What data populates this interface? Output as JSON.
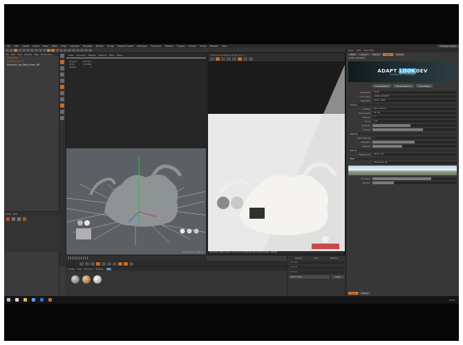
{
  "app": {
    "menu": [
      "File",
      "Edit",
      "Create",
      "Select",
      "Tools",
      "Mesh",
      "Snap",
      "Animate",
      "Simulate",
      "Render",
      "Sculpt",
      "Motion Tracker",
      "MoGraph",
      "Character",
      "Pipeline",
      "Plugins",
      "Octane",
      "Script",
      "Window",
      "Help"
    ],
    "layout_label": "Startup (User)"
  },
  "objects": {
    "header": [
      "File",
      "Edit",
      "View",
      "Objects",
      "Tags",
      "Bookmarks"
    ],
    "rows": [
      "OctaneSky",
      "LightRig_FG_01",
      "Dinosaur_Grp_Fight_Scene_HR"
    ]
  },
  "viewport": {
    "menu": [
      "View",
      "Cameras",
      "Display",
      "Options",
      "Filter",
      "Panel"
    ],
    "label": "Perspective",
    "stats_labels": [
      "Polygons",
      "Points",
      "Objects"
    ],
    "stats_values": [
      "2672914",
      "1341892",
      "4"
    ],
    "grid_label": "Grid Spacing : 1000 cm"
  },
  "liveviewer": {
    "title": "Octane Live Viewer Studio V3 [+]",
    "status": "Rendering: 100%  Ms/sec: 14.9  Time: 00:00:01/00:00:01  Spp/maxspp: 296/296"
  },
  "material": {
    "menu": [
      "Create",
      "Edit",
      "Function",
      "Texture"
    ],
    "filter": "All"
  },
  "coords": {
    "labels": [
      "Position",
      "Size",
      "Rotation"
    ],
    "rows": [
      "X 0 cm",
      "Y 0 cm",
      "Z 0 cm"
    ],
    "apply": "Apply",
    "mode": "Object (Rel)"
  },
  "attributes": {
    "header": [
      "Mode",
      "Edit",
      "User Data"
    ],
    "tabs": [
      "Basic",
      "Coord.",
      "Object",
      "ADAPT",
      "Phong"
    ],
    "object_name": "ADAPT_LOOKDEV",
    "banner_title_a": "ADAPT",
    "banner_title_b": "LOOK",
    "banner_title_c": "DEV",
    "banner_subtitle": "CINEMA 4D | OCTANE",
    "buttons": [
      "Load Material",
      "Reload Material",
      "Save Preset"
    ],
    "rows": [
      {
        "label": "Look Name",
        "value": "Studio"
      },
      {
        "label": "Look Folder",
        "value": "ADAPT_LOOKDEV"
      },
      {
        "label": "Resolution",
        "value": "1920 x 1080"
      },
      {
        "label": "Camera",
        "value": "Main Camera"
      },
      {
        "label": "Light Intensity",
        "value": "1"
      },
      {
        "label": "Focal Length",
        "value": "36 mm"
      },
      {
        "label": "Background",
        "value": "White 1.00"
      },
      {
        "label": "Aperture",
        "value": "0"
      },
      {
        "label": "Focus",
        "value": "Auto"
      }
    ],
    "sections": [
      "Camera",
      "Lighting",
      "Ground",
      "HDRI"
    ],
    "sliders": [
      {
        "label": "Exposure",
        "value": 0.45
      },
      {
        "label": "Gamma",
        "value": 0.6
      },
      {
        "label": "Saturation",
        "value": 0.5
      },
      {
        "label": "Shadows",
        "value": 0.35
      },
      {
        "label": "Sky Power",
        "value": 0.7
      },
      {
        "label": "Rotation",
        "value": 0.25
      }
    ],
    "hdri_label": "HDR Studio_04",
    "footer_tabs": [
      "Layer",
      "Octane"
    ]
  },
  "taskbar": {
    "clock": "14:23"
  },
  "colors": {
    "accent": "#e07b2a",
    "highlight": "#3a9fd5",
    "selected_object": "#e35050"
  }
}
